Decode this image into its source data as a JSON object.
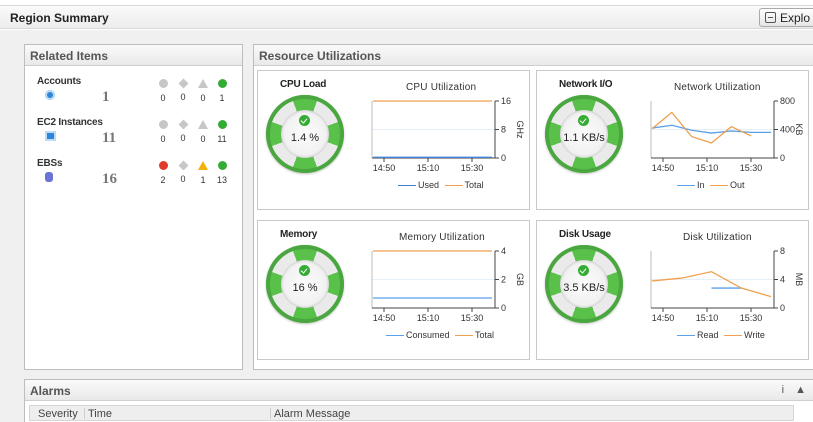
{
  "header": {
    "title": "Region Summary",
    "explore_label": "Explo"
  },
  "related": {
    "title": "Related Items",
    "groups": [
      {
        "name": "Accounts",
        "count": "1",
        "icon": "account-icon",
        "stats": [
          {
            "type": "critical-icon",
            "value": "0",
            "color": "#c7c7c7"
          },
          {
            "type": "major-icon",
            "value": "0",
            "color": "#c7c7c7"
          },
          {
            "type": "warning-icon",
            "value": "0",
            "color": "#c7c7c7"
          },
          {
            "type": "ok-icon",
            "value": "1",
            "color": "#34ac34"
          }
        ]
      },
      {
        "name": "EC2 Instances",
        "count": "11",
        "icon": "instance-icon",
        "stats": [
          {
            "type": "critical-icon",
            "value": "0",
            "color": "#c7c7c7"
          },
          {
            "type": "major-icon",
            "value": "0",
            "color": "#c7c7c7"
          },
          {
            "type": "warning-icon",
            "value": "0",
            "color": "#c7c7c7"
          },
          {
            "type": "ok-icon",
            "value": "11",
            "color": "#34ac34"
          }
        ]
      },
      {
        "name": "EBSs",
        "count": "16",
        "icon": "volume-icon",
        "stats": [
          {
            "type": "critical-icon",
            "value": "2",
            "color": "#e03a2a"
          },
          {
            "type": "major-icon",
            "value": "0",
            "color": "#c7c7c7"
          },
          {
            "type": "warning-icon",
            "value": "1",
            "color": "#f2b20e"
          },
          {
            "type": "ok-icon",
            "value": "13",
            "color": "#34ac34"
          }
        ]
      }
    ]
  },
  "resources": {
    "title": "Resource Utilizations",
    "cards": [
      {
        "label": "CPU Load",
        "gauge_value": "1.4 %",
        "chart_title": "CPU Utilization",
        "unit": "GHz",
        "yticks": [
          "16",
          "8",
          "0"
        ],
        "xticks": [
          "14:50",
          "15:10",
          "15:30"
        ],
        "series": [
          {
            "name": "Used",
            "color": "#3f7fd6"
          },
          {
            "name": "Total",
            "color": "#f0a050"
          }
        ]
      },
      {
        "label": "Network I/O",
        "gauge_value": "1.1 KB/s",
        "chart_title": "Network Utilization",
        "unit": "KB",
        "yticks": [
          "800",
          "400",
          "0"
        ],
        "xticks": [
          "14:50",
          "15:10",
          "15:30"
        ],
        "series": [
          {
            "name": "In",
            "color": "#5aa0ea"
          },
          {
            "name": "Out",
            "color": "#f0a050"
          }
        ]
      },
      {
        "label": "Memory",
        "gauge_value": "16 %",
        "chart_title": "Memory Utilization",
        "unit": "GB",
        "yticks": [
          "4",
          "2",
          "0"
        ],
        "xticks": [
          "14:50",
          "15:10",
          "15:30"
        ],
        "series": [
          {
            "name": "Consumed",
            "color": "#5aa0ea"
          },
          {
            "name": "Total",
            "color": "#f0a050"
          }
        ]
      },
      {
        "label": "Disk Usage",
        "gauge_value": "3.5 KB/s",
        "chart_title": "Disk Utilization",
        "unit": "MB",
        "yticks": [
          "8",
          "4",
          "0"
        ],
        "xticks": [
          "14:50",
          "15:10",
          "15:30"
        ],
        "series": [
          {
            "name": "Read",
            "color": "#5aa0ea"
          },
          {
            "name": "Write",
            "color": "#f0a050"
          }
        ]
      }
    ]
  },
  "chart_data": [
    {
      "type": "line",
      "title": "CPU Utilization",
      "ylabel": "GHz",
      "ylim": [
        0,
        16
      ],
      "x": [
        "14:45",
        "14:50",
        "15:00",
        "15:10",
        "15:20",
        "15:30",
        "15:35"
      ],
      "series": [
        {
          "name": "Used",
          "values": [
            0.2,
            0.2,
            0.2,
            0.2,
            0.2,
            0.2,
            0.2
          ]
        },
        {
          "name": "Total",
          "values": [
            16,
            16,
            16,
            16,
            16,
            16,
            16
          ]
        }
      ]
    },
    {
      "type": "line",
      "title": "Network Utilization",
      "ylabel": "KB",
      "ylim": [
        0,
        800
      ],
      "x": [
        "14:45",
        "14:55",
        "15:00",
        "15:10",
        "15:20",
        "15:30",
        "15:35"
      ],
      "series": [
        {
          "name": "In",
          "values": [
            420,
            460,
            390,
            350,
            380,
            360,
            360
          ]
        },
        {
          "name": "Out",
          "values": [
            410,
            640,
            300,
            210,
            440,
            310,
            null
          ]
        }
      ]
    },
    {
      "type": "line",
      "title": "Memory Utilization",
      "ylabel": "GB",
      "ylim": [
        0,
        4
      ],
      "x": [
        "14:45",
        "15:35"
      ],
      "series": [
        {
          "name": "Consumed",
          "values": [
            0.7,
            0.7
          ]
        },
        {
          "name": "Total",
          "values": [
            4,
            4
          ]
        }
      ]
    },
    {
      "type": "line",
      "title": "Disk Utilization",
      "ylabel": "MB",
      "ylim": [
        0,
        8
      ],
      "x": [
        "14:45",
        "15:00",
        "15:10",
        "15:20",
        "15:30"
      ],
      "series": [
        {
          "name": "Read",
          "values": [
            null,
            null,
            2.8,
            2.8,
            null
          ]
        },
        {
          "name": "Write",
          "values": [
            3.8,
            4.2,
            5.1,
            2.8,
            1.6
          ]
        }
      ]
    }
  ],
  "alarms": {
    "title": "Alarms",
    "info": "i",
    "collapse": "▲",
    "columns": [
      "Severity",
      "Time",
      "Alarm Message"
    ]
  }
}
